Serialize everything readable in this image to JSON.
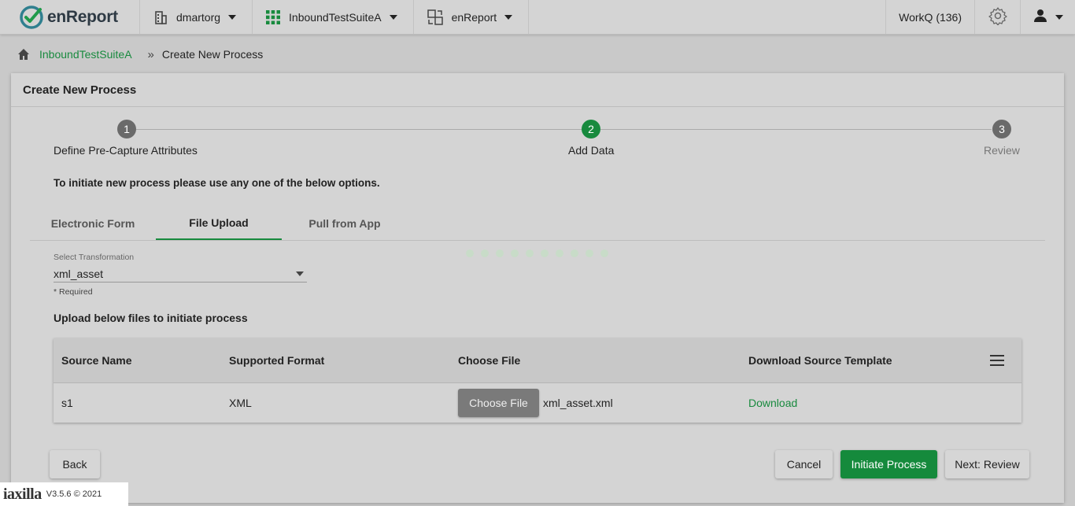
{
  "app": {
    "brand": "enReport"
  },
  "nav": {
    "org": "dmartorg",
    "suite": "InboundTestSuiteA",
    "app": "enReport",
    "workq": "WorkQ (136)"
  },
  "breadcrumb": {
    "home_link": "InboundTestSuiteA",
    "separator": "»",
    "current": "Create New Process"
  },
  "card": {
    "title": "Create New Process"
  },
  "steps": [
    {
      "num": "1",
      "label": "Define Pre-Capture Attributes"
    },
    {
      "num": "2",
      "label": "Add Data"
    },
    {
      "num": "3",
      "label": "Review"
    }
  ],
  "intro": "To initiate new process please use any one of the below options.",
  "tabs": [
    "Electronic Form",
    "File Upload",
    "Pull from App"
  ],
  "transformation": {
    "label": "Select Transformation",
    "value": "xml_asset",
    "required_note": "* Required"
  },
  "upload_title": "Upload below files to initiate process",
  "table": {
    "headers": [
      "Source Name",
      "Supported Format",
      "Choose File",
      "Download Source Template"
    ],
    "rows": [
      {
        "source": "s1",
        "format": "XML",
        "button": "Choose File",
        "file": "xml_asset.xml",
        "download": "Download"
      }
    ]
  },
  "buttons": {
    "back": "Back",
    "cancel": "Cancel",
    "initiate": "Initiate Process",
    "next": "Next: Review"
  },
  "footer": {
    "brand": "iaxilla",
    "version": "V3.5.6 © 2021"
  },
  "colors": {
    "accent": "#188a3e",
    "step_inactive": "#6a6a6a"
  }
}
